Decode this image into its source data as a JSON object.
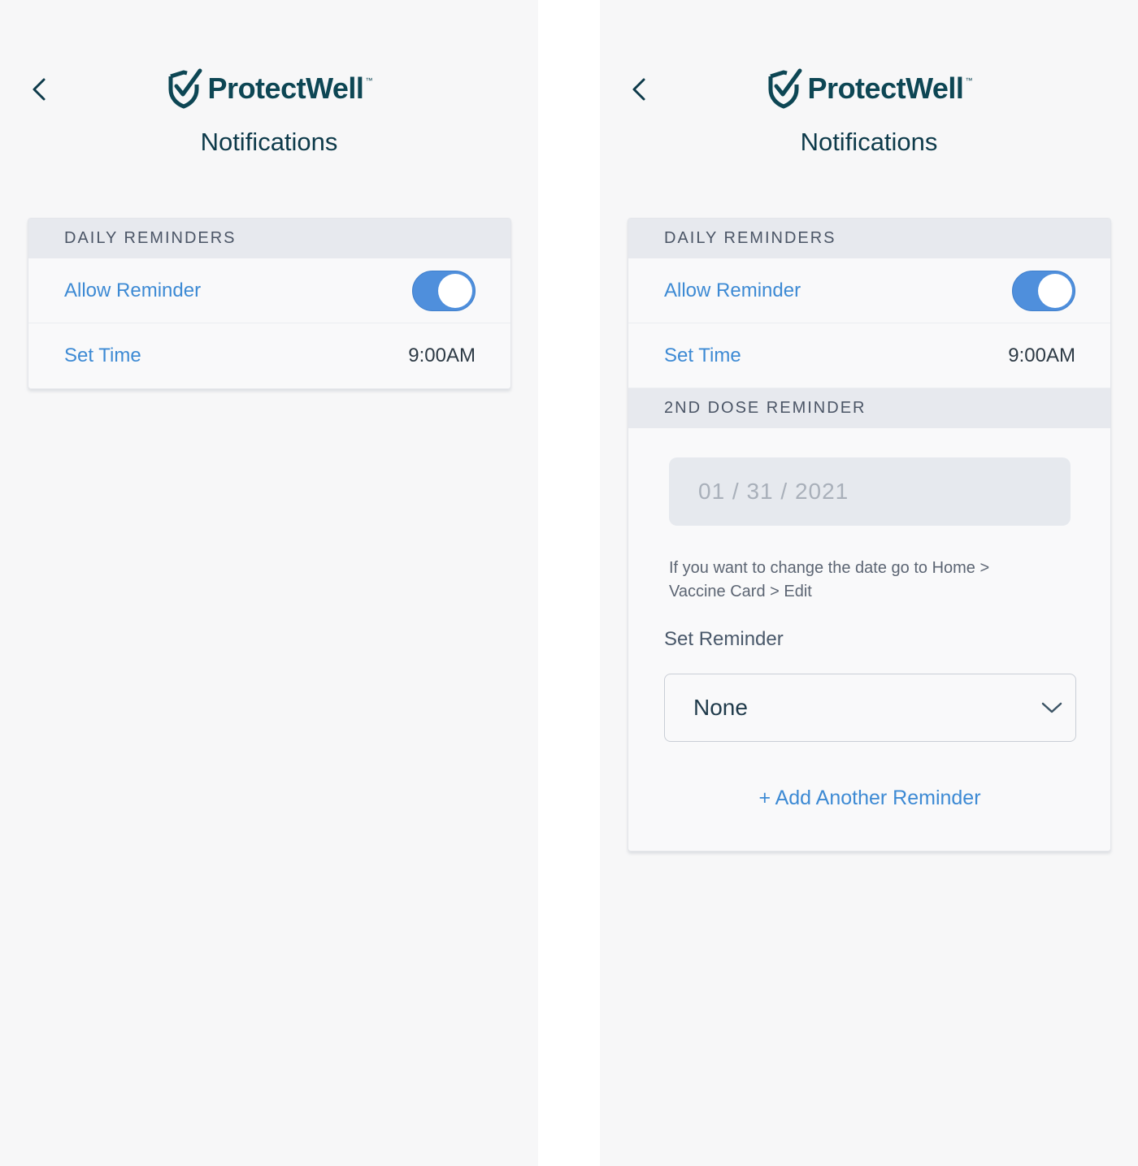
{
  "left_screen": {
    "brand_name": "ProtectWell",
    "brand_tm": "™",
    "title": "Notifications",
    "daily_reminders": {
      "header": "DAILY REMINDERS",
      "allow_label": "Allow Reminder",
      "allow_enabled": true,
      "set_time_label": "Set Time",
      "set_time_value": "9:00AM"
    }
  },
  "right_screen": {
    "brand_name": "ProtectWell",
    "brand_tm": "™",
    "title": "Notifications",
    "daily_reminders": {
      "header": "DAILY REMINDERS",
      "allow_label": "Allow Reminder",
      "allow_enabled": true,
      "set_time_label": "Set Time",
      "set_time_value": "9:00AM"
    },
    "second_dose": {
      "header": "2ND DOSE REMINDER",
      "date_value": "01 / 31 / 2021",
      "helper_text": "If you want to change the date go to Home > Vaccine Card > Edit",
      "set_reminder_label": "Set Reminder",
      "reminder_selected": "None",
      "add_link": "+ Add Another Reminder"
    }
  },
  "icons": {
    "back": "chevron-left-icon",
    "logo": "shield-check-icon",
    "select": "chevron-down-icon"
  },
  "colors": {
    "brand": "#0d4654",
    "accent": "#3d8ad4",
    "toggle_on": "#4f8fdc",
    "section_header_bg": "#e7e9ee",
    "screen_bg": "#f7f7f8"
  }
}
